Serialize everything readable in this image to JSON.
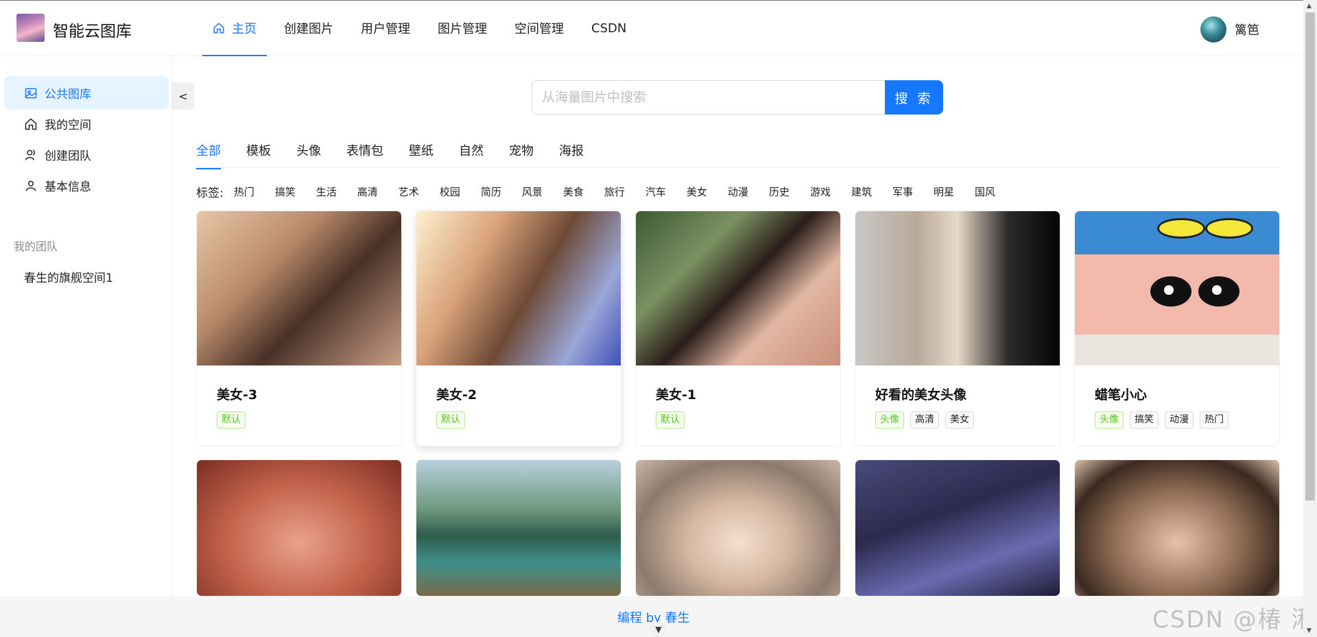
{
  "header": {
    "logo_title": "智能云图库",
    "nav": [
      {
        "label": "主页",
        "active": true
      },
      {
        "label": "创建图片"
      },
      {
        "label": "用户管理"
      },
      {
        "label": "图片管理"
      },
      {
        "label": "空间管理"
      },
      {
        "label": "CSDN"
      }
    ],
    "user_name": "篱笆"
  },
  "sidebar": {
    "items": [
      {
        "label": "公共图库",
        "icon": "picture-icon",
        "active": true
      },
      {
        "label": "我的空间",
        "icon": "home-icon"
      },
      {
        "label": "创建团队",
        "icon": "team-icon"
      },
      {
        "label": "基本信息",
        "icon": "user-icon"
      }
    ],
    "group_title": "我的团队",
    "group_items": [
      "春生的旗舰空间1"
    ],
    "collapse_label": "<"
  },
  "search": {
    "placeholder": "从海量图片中搜索",
    "button_label": "搜 索"
  },
  "categories": [
    "全部",
    "模板",
    "头像",
    "表情包",
    "壁纸",
    "自然",
    "宠物",
    "海报"
  ],
  "tags": {
    "label": "标签:",
    "items": [
      "热门",
      "搞笑",
      "生活",
      "高清",
      "艺术",
      "校园",
      "简历",
      "风景",
      "美食",
      "旅行",
      "汽车",
      "美女",
      "动漫",
      "历史",
      "游戏",
      "建筑",
      "军事",
      "明星",
      "国风"
    ]
  },
  "cards": [
    {
      "title": "美女-3",
      "tags": [
        "默认"
      ]
    },
    {
      "title": "美女-2",
      "tags": [
        "默认"
      ]
    },
    {
      "title": "美女-1",
      "tags": [
        "默认"
      ]
    },
    {
      "title": "好看的美女头像",
      "tags": [
        "头像",
        "高清",
        "美女"
      ]
    },
    {
      "title": "蜡笔小心",
      "tags": [
        "头像",
        "搞笑",
        "动漫",
        "热门"
      ]
    }
  ],
  "footer": {
    "link": "编程 by 春生"
  },
  "watermark": "CSDN @椿  湫",
  "colors": {
    "accent": "#1677ff",
    "tag_green": "#52c41a"
  }
}
